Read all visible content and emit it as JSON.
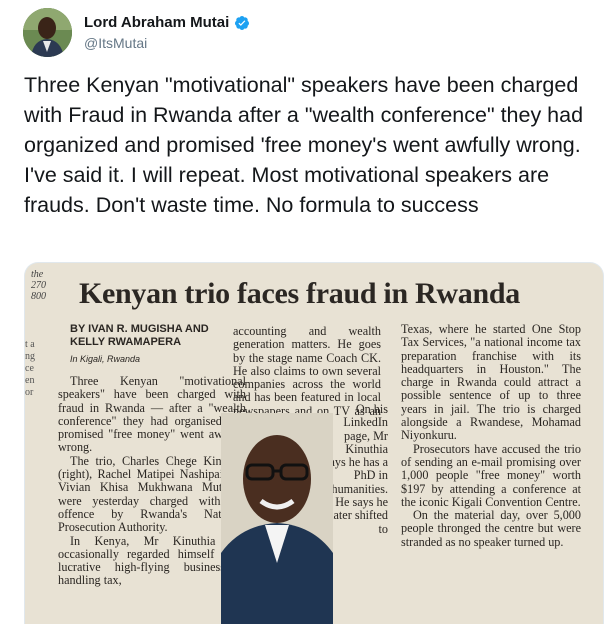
{
  "user": {
    "display_name": "Lord Abraham Mutai",
    "handle": "@ItsMutai",
    "verified": true
  },
  "tweet": {
    "text": "Three Kenyan \"motivational\" speakers have been charged with Fraud in Rwanda after a \"wealth conference\" they had organized and promised 'free money's went awfully wrong. I've said it. I will repeat. Most motivational speakers are frauds. Don't waste time. No formula to success"
  },
  "media": {
    "margin_text": [
      "the",
      "270",
      "800"
    ],
    "left_margin": [
      "t a",
      "ng",
      "ce",
      "en",
      "or"
    ],
    "headline": "Kenyan trio faces fraud in Rwanda",
    "byline_1": "BY IVAN R. MUGISHA AND",
    "byline_2": "KELLY RWAMAPERA",
    "dateline": "In Kigali, Rwanda",
    "col1_p1": "Three Kenyan \"motivational speakers\" have been charged with fraud in Rwanda — after a \"wealth conference\" they had organised and promised \"free money\" went awfully wrong.",
    "col1_p2": "The trio, Charles Chege Kinuthia (right), Rachel Matipei Nashipai and Vivian Khisa Mukhwana Mutenyo were yesterday charged with the offence by Rwanda's National Prosecution Authority.",
    "col1_p3": "In Kenya, Mr Kinuthia has occasionally regarded himself as a lucrative high-flying businessman handling tax,",
    "col2_top": "accounting and wealth generation matters. He goes by the stage name Coach CK. He also claims to own several companies across the world and has been featured in local newspapers and on TV as an entrepreneur.",
    "col2_wrap": "On his LinkedIn page, Mr Kinuthia says he has a PhD in humanities. He says he later shifted to",
    "col3_p1": "Texas, where he started One Stop Tax Services, \"a national income tax preparation franchise with its headquarters in Houston.\" The charge in Rwanda could attract a possible sentence of up to three years in jail. The trio is charged alongside a Rwandese, Mohamad Niyonkuru.",
    "col3_p2": "Prosecutors have accused the trio of sending an e-mail promising over 1,000 people \"free money\" worth $197 by attending a conference at the iconic Kigali Convention Centre.",
    "col3_p3": "On the material day, over 5,000 people thronged the centre but were stranded as no speaker turned up."
  },
  "colors": {
    "name": "#14171a",
    "handle": "#657786",
    "verified": "#1da1f2",
    "paper": "#e8e2d4"
  }
}
